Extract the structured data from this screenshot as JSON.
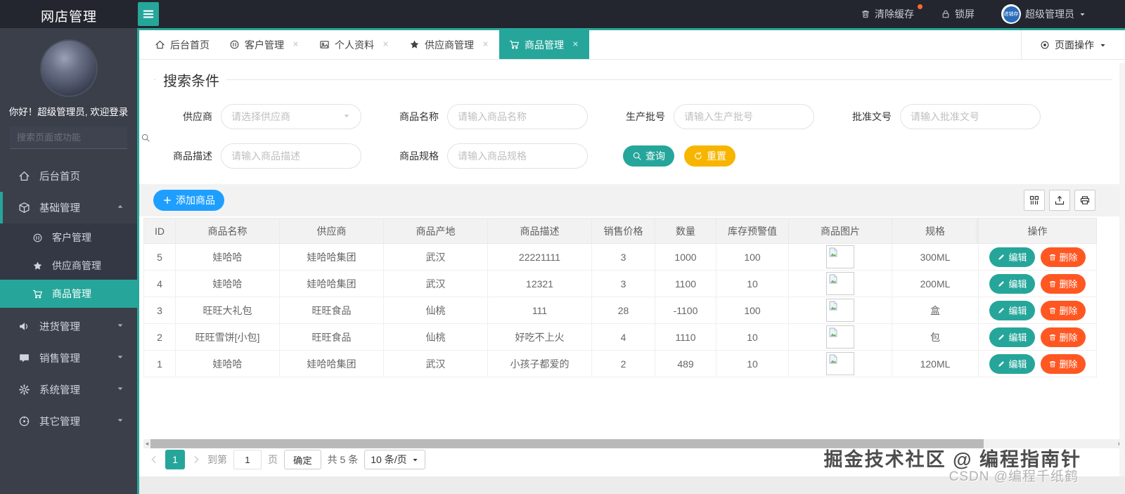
{
  "topbar": {
    "app_title": "网店管理",
    "clear_cache_label": "清除缓存",
    "lock_label": "锁屏",
    "username": "超级管理员",
    "logo_text": "进销存"
  },
  "sidebar": {
    "greeting": "你好！超级管理员, 欢迎登录",
    "search_placeholder": "搜索页面或功能",
    "menu": [
      {
        "label": "后台首页",
        "icon": "home-icon",
        "type": "item"
      },
      {
        "label": "基础管理",
        "icon": "cube-icon",
        "type": "group",
        "expanded": true,
        "children": [
          {
            "label": "客户管理",
            "icon": "pause-circle-icon",
            "active": false
          },
          {
            "label": "供应商管理",
            "icon": "star-icon",
            "active": false
          },
          {
            "label": "商品管理",
            "icon": "cart-icon",
            "active": true
          }
        ]
      },
      {
        "label": "进货管理",
        "icon": "speaker-icon",
        "type": "group",
        "expanded": false
      },
      {
        "label": "销售管理",
        "icon": "chat-icon",
        "type": "group",
        "expanded": false
      },
      {
        "label": "系统管理",
        "icon": "gear-icon",
        "type": "group",
        "expanded": false
      },
      {
        "label": "其它管理",
        "icon": "compass-icon",
        "type": "group",
        "expanded": false
      }
    ]
  },
  "tabbar": {
    "tabs": [
      {
        "label": "后台首页",
        "icon": "home-icon",
        "closable": false,
        "active": false
      },
      {
        "label": "客户管理",
        "icon": "pause-circle-icon",
        "closable": true,
        "active": false
      },
      {
        "label": "个人资料",
        "icon": "id-card-icon",
        "closable": true,
        "active": false
      },
      {
        "label": "供应商管理",
        "icon": "star-icon",
        "closable": true,
        "active": false
      },
      {
        "label": "商品管理",
        "icon": "cart-icon",
        "closable": true,
        "active": true
      }
    ],
    "page_actions_label": "页面操作"
  },
  "search_panel": {
    "legend": "搜索条件",
    "row1": [
      {
        "label": "供应商",
        "placeholder": "请选择供应商",
        "type": "select"
      },
      {
        "label": "商品名称",
        "placeholder": "请输入商品名称",
        "type": "input"
      },
      {
        "label": "生产批号",
        "placeholder": "请输入生产批号",
        "type": "input"
      },
      {
        "label": "批准文号",
        "placeholder": "请输入批准文号",
        "type": "input"
      }
    ],
    "row2": [
      {
        "label": "商品描述",
        "placeholder": "请输入商品描述",
        "type": "input"
      },
      {
        "label": "商品规格",
        "placeholder": "请输入商品规格",
        "type": "input"
      }
    ],
    "query_button": "查询",
    "reset_button": "重置"
  },
  "toolbar": {
    "add_button": "添加商品",
    "icon_buttons": [
      "columns-grid-icon",
      "export-icon",
      "print-icon"
    ]
  },
  "table": {
    "headers": [
      "ID",
      "商品名称",
      "供应商",
      "商品产地",
      "商品描述",
      "销售价格",
      "数量",
      "库存预警值",
      "商品图片",
      "规格",
      "操作"
    ],
    "rows": [
      {
        "id": "5",
        "name": "娃哈哈",
        "supplier": "娃哈哈集团",
        "origin": "武汉",
        "desc": "22221111",
        "price": "3",
        "qty": "1000",
        "warn": "100",
        "image": "broken-image",
        "spec": "300ML"
      },
      {
        "id": "4",
        "name": "娃哈哈",
        "supplier": "娃哈哈集团",
        "origin": "武汉",
        "desc": "12321",
        "price": "3",
        "qty": "1100",
        "warn": "10",
        "image": "broken-image",
        "spec": "200ML"
      },
      {
        "id": "3",
        "name": "旺旺大礼包",
        "supplier": "旺旺食品",
        "origin": "仙桃",
        "desc": "111",
        "price": "28",
        "qty": "-1100",
        "warn": "100",
        "image": "broken-image",
        "spec": "盒"
      },
      {
        "id": "2",
        "name": "旺旺雪饼[小包]",
        "supplier": "旺旺食品",
        "origin": "仙桃",
        "desc": "好吃不上火",
        "price": "4",
        "qty": "1110",
        "warn": "10",
        "image": "broken-image",
        "spec": "包"
      },
      {
        "id": "1",
        "name": "娃哈哈",
        "supplier": "娃哈哈集团",
        "origin": "武汉",
        "desc": "小孩子都爱的",
        "price": "2",
        "qty": "489",
        "warn": "10",
        "image": "broken-image",
        "spec": "120ML"
      }
    ],
    "edit_button": "编辑",
    "delete_button": "删除"
  },
  "pagination": {
    "current_page": "1",
    "goto_label": "到第",
    "goto_value": "1",
    "page_label": "页",
    "confirm_button": "确定",
    "total_text": "共 5 条",
    "page_size": "10 条/页"
  },
  "watermark": {
    "line1": "掘金技术社区 @ 编程指南针",
    "line2": "CSDN @编程千纸鹤"
  },
  "colors": {
    "accent": "#26a69a",
    "blue": "#1e9fff",
    "yellow": "#f7b500",
    "orange": "#ff5722",
    "topbar_bg": "#23262e",
    "sidebar_bg": "#3b3f4a",
    "submenu_bg": "#343845",
    "table_header_bg": "#f2f2f2"
  }
}
